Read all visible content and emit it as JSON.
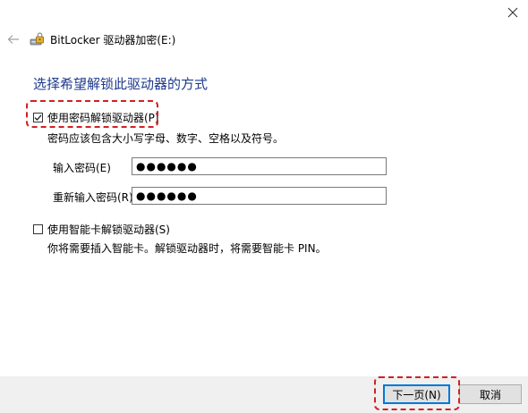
{
  "window": {
    "title": "BitLocker 驱动器加密(E:)",
    "close_glyph": "✕"
  },
  "icons": {
    "back": "back-arrow-icon",
    "app": "bitlocker-drive-icon",
    "close": "close-icon",
    "check": "checkmark-icon"
  },
  "main": {
    "heading": "选择希望解锁此驱动器的方式",
    "password_option": {
      "label": "使用密码解锁驱动器(P)",
      "checked": true,
      "hint": "密码应该包含大小写字母、数字、空格以及符号。",
      "enter_label": "输入密码(E)",
      "enter_value": "●●●●●●",
      "reenter_label": "重新输入密码(R)",
      "reenter_value": "●●●●●●"
    },
    "smartcard_option": {
      "label": "使用智能卡解锁驱动器(S)",
      "checked": false,
      "hint": "你将需要插入智能卡。解锁驱动器时，将需要智能卡 PIN。"
    }
  },
  "footer": {
    "next_label": "下一页(N)",
    "cancel_label": "取消"
  },
  "colors": {
    "heading": "#1e3a8c",
    "highlight": "#d32020",
    "footer_bg": "#f0f0f0",
    "primary_border": "#0078d7"
  }
}
